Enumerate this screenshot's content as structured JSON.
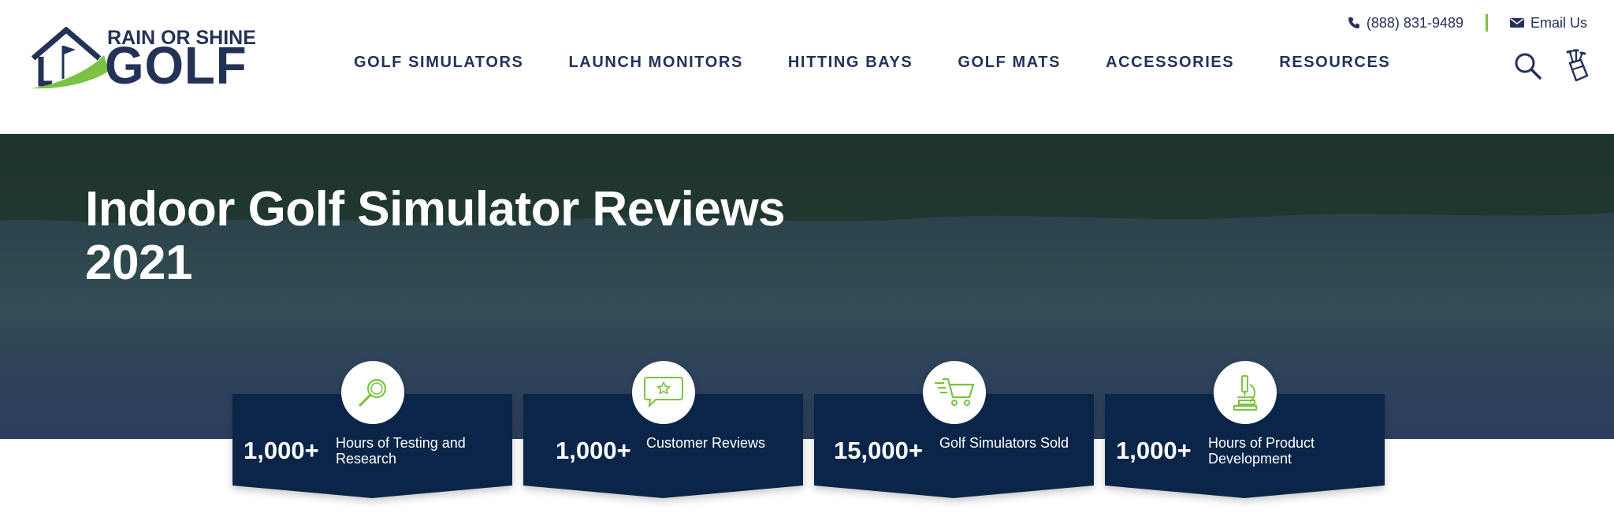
{
  "brand": {
    "top_text": "RAIN OR SHINE",
    "main_text": "GOLF"
  },
  "contact": {
    "phone": "(888) 831-9489",
    "email_label": "Email Us"
  },
  "nav": {
    "items": [
      {
        "label": "GOLF SIMULATORS"
      },
      {
        "label": "LAUNCH MONITORS"
      },
      {
        "label": "HITTING BAYS"
      },
      {
        "label": "GOLF MATS"
      },
      {
        "label": "ACCESSORIES"
      },
      {
        "label": "RESOURCES"
      }
    ]
  },
  "hero": {
    "title": "Indoor Golf Simulator Reviews 2021"
  },
  "stats": [
    {
      "value": "1,000+",
      "label": "Hours of Testing and Research",
      "icon": "magnifier-icon"
    },
    {
      "value": "1,000+",
      "label": "Customer Reviews",
      "icon": "review-star-icon"
    },
    {
      "value": "15,000+",
      "label": "Golf Simulators Sold",
      "icon": "shopping-cart-icon"
    },
    {
      "value": "1,000+",
      "label": "Hours of Product Development",
      "icon": "microscope-icon"
    }
  ],
  "colors": {
    "navy": "#0b2549",
    "brand_text": "#233257",
    "accent_green": "#7cc242"
  }
}
